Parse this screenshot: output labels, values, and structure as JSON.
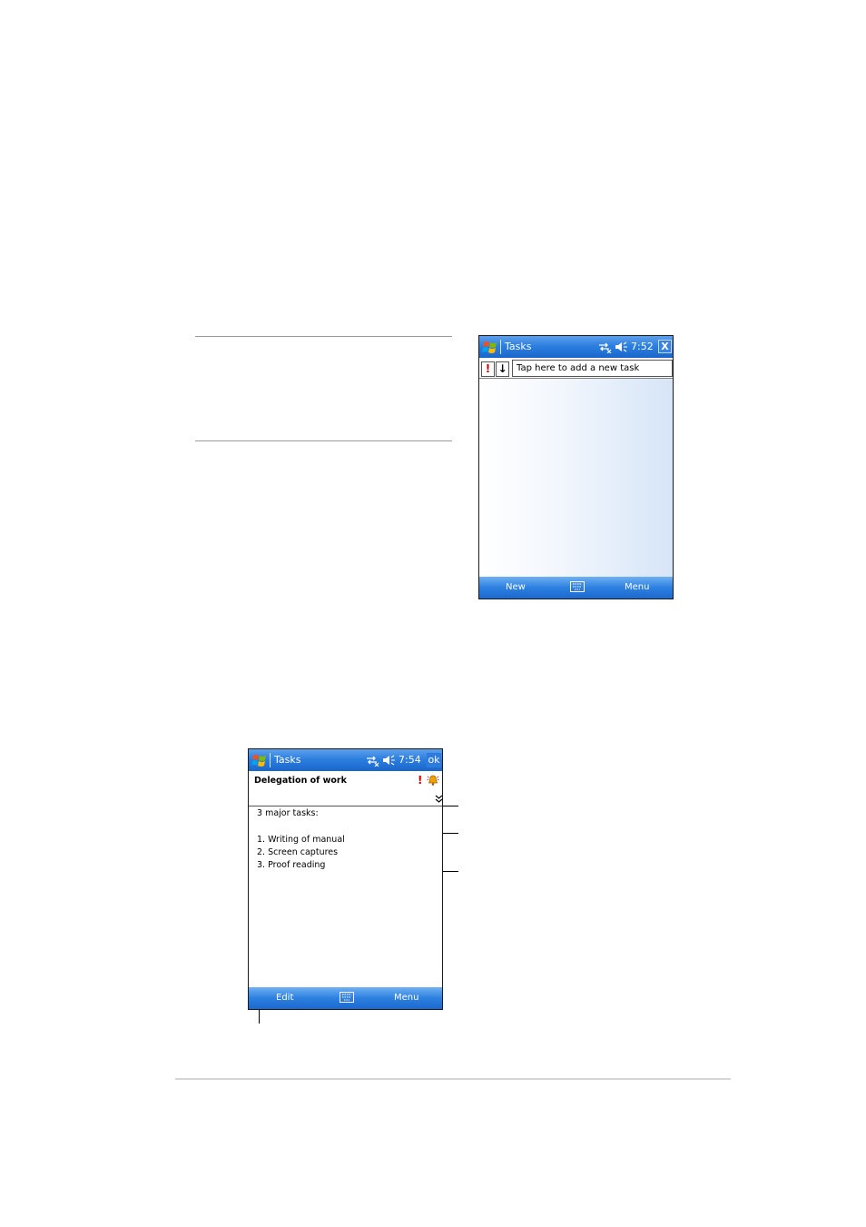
{
  "screen1": {
    "title": "Tasks",
    "time": "7:52",
    "close_label": "X",
    "priority_sort": "!",
    "due_sort": "↓",
    "add_task_placeholder": "Tap here to add a new task",
    "menu_left": "New",
    "menu_right": "Menu"
  },
  "screen2": {
    "title": "Tasks",
    "time": "7:54",
    "ok_label": "ok",
    "subject": "Delegation of work",
    "priority_mark": "!",
    "notes": [
      "3 major tasks:",
      "1. Writing of manual",
      "2. Screen captures",
      "3. Proof reading"
    ],
    "menu_left": "Edit",
    "menu_right": "Menu"
  },
  "colors": {
    "title_bar": "#2d7fdf",
    "menu_bar": "#2d80e0",
    "priority_red": "#d80000"
  }
}
